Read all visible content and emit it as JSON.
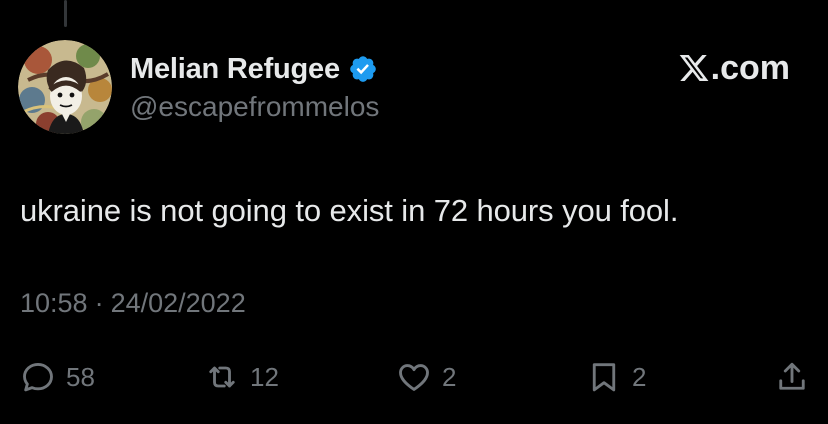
{
  "author": {
    "display_name": "Melian Refugee",
    "handle": "@escapefrommelos",
    "verified": true,
    "verified_color": "#1d9bf0"
  },
  "brand": {
    "text": ".com",
    "icon": "x-logo-icon"
  },
  "tweet": {
    "text": "ukraine is not going to exist in 72 hours you fool.",
    "time": "10:58",
    "separator": "·",
    "date": "24/02/2022"
  },
  "actions": {
    "replies": "58",
    "reposts": "12",
    "likes": "2",
    "bookmarks": "2",
    "icons": [
      "reply-icon",
      "repost-icon",
      "like-icon",
      "bookmark-icon",
      "share-icon"
    ]
  },
  "colors": {
    "background": "#000000",
    "primary_text": "#e7e9ea",
    "secondary_text": "#71767b",
    "verified_blue": "#1d9bf0"
  }
}
